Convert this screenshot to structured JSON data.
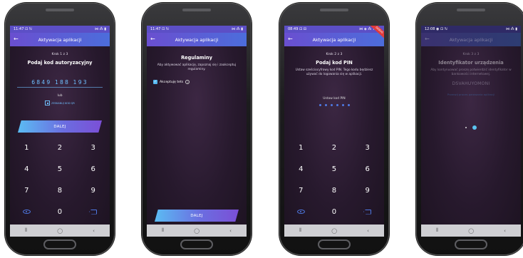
{
  "phones": [
    {
      "status_time": "11:47",
      "status_icons_left": "⊡ ℕ",
      "status_icons_right": "⋈ ⁂ ▮",
      "appbar_title": "Aktywacja aplikacji",
      "step": "Krok 1 z 3",
      "title": "Podaj kod autoryzacyjny",
      "code": "6849 188 193",
      "or_text": "lub",
      "qr_link": "ZESKANUJ KOD QR",
      "button": "DALEJ",
      "keys": [
        "1",
        "2",
        "3",
        "4",
        "5",
        "6",
        "7",
        "8",
        "9",
        "",
        "0",
        ""
      ]
    },
    {
      "status_time": "11:47",
      "status_icons_left": "⊡ ℕ",
      "status_icons_right": "⋈ ⁂ ▮",
      "appbar_title": "Aktywacja aplikacji",
      "title": "Regulaminy",
      "desc": "Aby aktywować aplikację, zapoznaj się i zaakceptuj regulaminy.",
      "checkbox_label": "Akceptuję tets",
      "checkbox_mark": "✓",
      "info_mark": "i",
      "button": "DALEJ"
    },
    {
      "status_time": "08:49",
      "status_icons_left": "⊡ ⊟",
      "status_icons_right": "⋈ ◈ ⁂ 74%",
      "appbar_title": "Aktywacja aplikacji",
      "debug_badge": "DEBUG",
      "step": "Krok 2 z 3",
      "title": "Podaj kod PIN",
      "desc": "Ustaw sześciocyfrowy kod PIN. Tego kodu będziesz używać do logowania się w aplikacji.",
      "pin_label": "Ustaw kod PIN",
      "pin_count": 6,
      "keys": [
        "1",
        "2",
        "3",
        "4",
        "5",
        "6",
        "7",
        "8",
        "9",
        "",
        "0",
        ""
      ]
    },
    {
      "status_time": "12:08",
      "status_icons_left": "◉ ⊡ ℕ",
      "status_icons_right": "⋈ ⁂ ▮",
      "appbar_title": "Aktywacja aplikacji",
      "step": "Krok 3 z 3",
      "title": "Identyfikator urządzenia",
      "desc": "Aby kontynuować proszę potwierdzić identyfikator w bankowości internetowej.",
      "device_id": "DSVAHUYOMONI",
      "link": "Przerwij proces parowania aplikacji"
    }
  ],
  "navbar": {
    "recent": "⦀",
    "home": "◯",
    "back": "‹"
  },
  "icons": {
    "back": "←"
  },
  "colors": {
    "accent": "#6fc0ff",
    "appbar": "#5c4fc6",
    "background": "#27192d"
  }
}
